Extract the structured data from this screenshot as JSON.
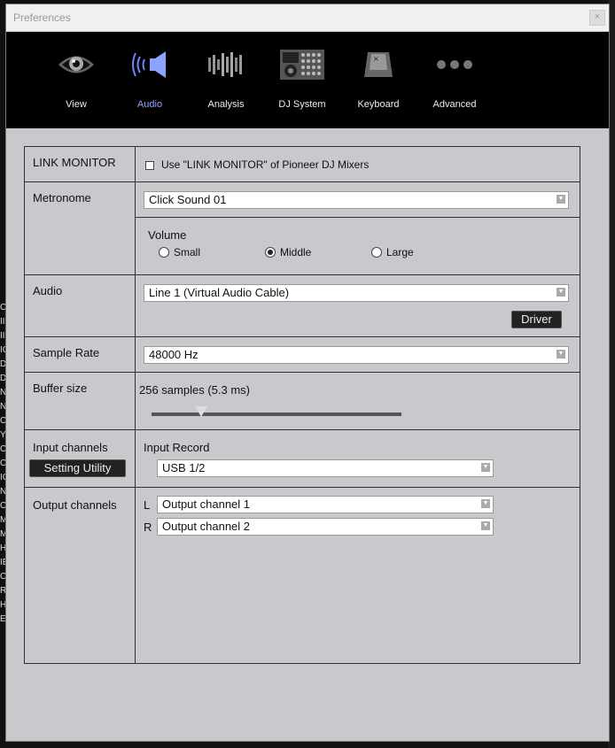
{
  "window": {
    "title": "Preferences",
    "close_label": "×"
  },
  "toolbar": {
    "items": [
      {
        "label": "View"
      },
      {
        "label": "Audio"
      },
      {
        "label": "Analysis"
      },
      {
        "label": "DJ System"
      },
      {
        "label": "Keyboard"
      },
      {
        "label": "Advanced"
      }
    ],
    "active": "Audio",
    "active_color": "#8ea3ff"
  },
  "link_monitor": {
    "label": "LINK MONITOR",
    "checkbox_label": "Use \"LINK MONITOR\" of Pioneer DJ Mixers",
    "checked": false
  },
  "metronome": {
    "label": "Metronome",
    "sound": "Click Sound 01",
    "volume_label": "Volume",
    "options": [
      "Small",
      "Middle",
      "Large"
    ],
    "selected": "Middle"
  },
  "audio": {
    "label": "Audio",
    "device": "Line 1 (Virtual Audio Cable)",
    "driver_button": "Driver"
  },
  "sample_rate": {
    "label": "Sample Rate",
    "value": "48000 Hz"
  },
  "buffer_size": {
    "label": "Buffer size",
    "value_text": "256 samples (5.3 ms)",
    "slider_position": 0.2
  },
  "input_channels": {
    "label": "Input channels",
    "setting_button": "Setting Utility",
    "record_label": "Input Record",
    "record_value": "USB 1/2"
  },
  "output_channels": {
    "label": "Output channels",
    "left_label": "L",
    "left_value": "Output channel 1",
    "right_label": "R",
    "right_value": "Output channel 2"
  },
  "background_fragments": [
    "C",
    "II",
    "II",
    "IC",
    "De",
    "De",
    "N",
    "N",
    "Cl",
    "Y",
    "Cl",
    "Cl",
    "IC",
    "N",
    "C",
    "M",
    "M",
    "H",
    "IE",
    "C",
    "R",
    "H",
    "E",
    "i"
  ]
}
